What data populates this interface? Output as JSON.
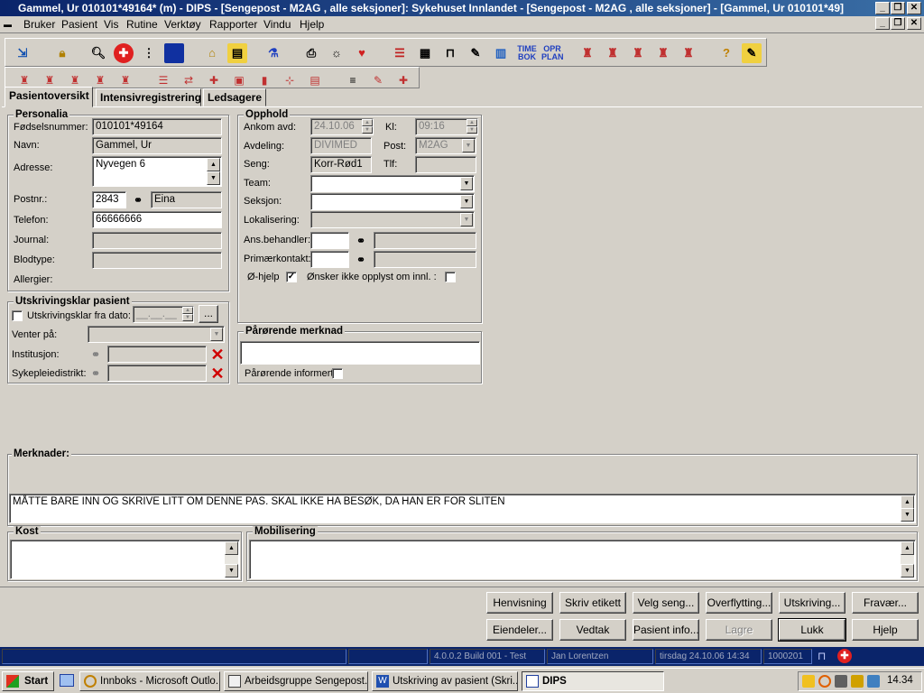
{
  "window": {
    "title": "Gammel, Ur  010101*49164* (m) - DIPS - [Sengepost - M2AG , alle seksjoner]: Sykehuset Innlandet - [Sengepost - M2AG , alle seksjoner] - [Gammel, Ur  010101*49]",
    "minimize": "_",
    "restore": "❐",
    "close": "✕"
  },
  "menu": [
    "Bruker",
    "Pasient",
    "Vis",
    "Rutine",
    "Verktøy",
    "Rapporter",
    "Vindu",
    "Hjelp"
  ],
  "toolbar": {
    "time_bok": "TIME\nBOK",
    "opr_plan": "OPR\nPLAN"
  },
  "tabs": [
    "Pasientoversikt",
    "Intensivregistrering",
    "Ledsagere"
  ],
  "personalia": {
    "title": "Personalia",
    "fodselsnummer_label": "Fødselsnummer:",
    "fodselsnummer": "010101*49164",
    "navn_label": "Navn:",
    "navn": "Gammel, Ur",
    "adresse_label": "Adresse:",
    "adresse": "Nyvegen 6",
    "postnr_label": "Postnr.:",
    "postnr": "2843",
    "poststed": "Eina",
    "telefon_label": "Telefon:",
    "telefon": "66666666",
    "journal_label": "Journal:",
    "journal": "",
    "blodtype_label": "Blodtype:",
    "blodtype": "",
    "allergier_label": "Allergier:"
  },
  "opphold": {
    "title": "Opphold",
    "ankom_label": "Ankom avd:",
    "ankom": "24.10.06",
    "kl_label": "Kl:",
    "kl": "09:16",
    "avdeling_label": "Avdeling:",
    "avdeling": "DIVIMED",
    "post_label": "Post:",
    "post": "M2AG",
    "seng_label": "Seng:",
    "seng": "Korr-Rød1",
    "tlf_label": "Tlf:",
    "tlf": "",
    "team_label": "Team:",
    "team": "",
    "seksjon_label": "Seksjon:",
    "seksjon": "",
    "lokalisering_label": "Lokalisering:",
    "lokalisering": "",
    "ansbehandler_label": "Ans.behandler:",
    "ansbehandler": "",
    "primaerkontakt_label": "Primærkontakt:",
    "primaerkontakt": "",
    "ohjelp_label": "Ø-hjelp",
    "ohjelp_checked": "✓",
    "onsker_label": "Ønsker ikke opplyst om innl. :"
  },
  "utskrivingsklar": {
    "title": "Utskrivingsklar pasient",
    "fra_dato_label": "Utskrivingsklar fra dato:",
    "fra_dato": "__.__.__",
    "dots": "...",
    "venter_label": "Venter på:",
    "institusjon_label": "Institusjon:",
    "sykepleiedistrikt_label": "Sykepleiedistrikt:"
  },
  "parorende": {
    "title": "Pårørende merknad",
    "informert_label": "Pårørende informert"
  },
  "merknader": {
    "title": "Merknader:",
    "text": "MÅTTE BARE INN OG SKRIVE LITT OM DENNE PAS. SKAL IKKE HA BESØK, DA HAN ER FOR SLITEN"
  },
  "kost": {
    "title": "Kost"
  },
  "mobilisering": {
    "title": "Mobilisering"
  },
  "buttons": {
    "henvisning": "Henvisning",
    "skriv_etikett": "Skriv etikett",
    "velg_seng": "Velg seng...",
    "overflytting": "Overflytting...",
    "utskriving": "Utskriving...",
    "fravaer": "Fravær...",
    "eiendeler": "Eiendeler...",
    "vedtak": "Vedtak",
    "pasient_info": "Pasient info...",
    "lagre": "Lagre",
    "lukk": "Lukk",
    "hjelp": "Hjelp"
  },
  "status": {
    "version": "4.0.0.2 Build 001 - Test",
    "user": "Jan Lorentzen",
    "datetime": "tirsdag 24.10.06 14:34",
    "code": "1000201"
  },
  "taskbar": {
    "start": "Start",
    "tasks": [
      "Innboks - Microsoft Outlo...",
      "Arbeidsgruppe Sengepost...",
      "Utskriving av pasient (Skri...",
      "DIPS"
    ],
    "clock": "14.34"
  },
  "colors": {
    "titlebar": "#0a246a",
    "face": "#d4d0c8",
    "statusbar": "#0a246a"
  }
}
